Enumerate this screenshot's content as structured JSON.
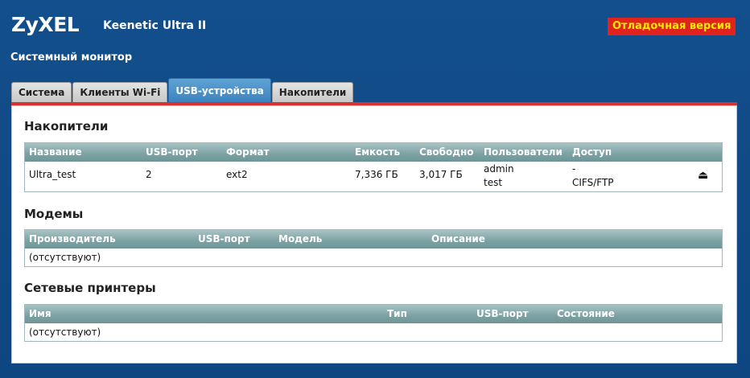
{
  "header": {
    "logo": "ZyXEL",
    "model": "Keenetic Ultra II",
    "debug_badge": "Отладочная версия"
  },
  "page_title": "Системный монитор",
  "tabs": [
    {
      "label": "Система",
      "active": false
    },
    {
      "label": "Клиенты Wi-Fi",
      "active": false
    },
    {
      "label": "USB-устройства",
      "active": true
    },
    {
      "label": "Накопители",
      "active": false
    }
  ],
  "storage": {
    "title": "Накопители",
    "columns": [
      "Название",
      "USB-порт",
      "Формат",
      "Емкость",
      "Свободно",
      "Пользователи",
      "Доступ"
    ],
    "rows": [
      {
        "name": "Ultra_test",
        "usb_port": "2",
        "format": "ext2",
        "capacity": "7,336 ГБ",
        "free": "3,017 ГБ",
        "users": [
          "admin",
          "test"
        ],
        "access": [
          "-",
          "CIFS/FTP"
        ],
        "eject_icon": "eject-icon"
      }
    ]
  },
  "modems": {
    "title": "Модемы",
    "columns": [
      "Производитель",
      "USB-порт",
      "Модель",
      "Описание"
    ],
    "empty": "(отсутствуют)"
  },
  "printers": {
    "title": "Сетевые принтеры",
    "columns": [
      "Имя",
      "Тип",
      "USB-порт",
      "Состояние"
    ],
    "empty": "(отсутствуют)"
  }
}
